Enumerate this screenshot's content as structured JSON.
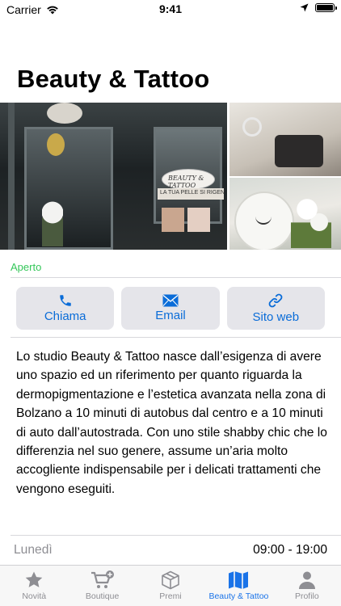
{
  "status_bar": {
    "carrier": "Carrier",
    "time": "9:41"
  },
  "page": {
    "title": "Beauty & Tattoo"
  },
  "gallery": {
    "main_photo": {
      "sign_text": "BEAUTY & TATTOO",
      "banner_text": "LA TUA PELLE SI RIGEN"
    }
  },
  "open_status": {
    "text": "Aperto",
    "color": "#34c759"
  },
  "actions": [
    {
      "label": "Chiama",
      "icon": "phone-icon"
    },
    {
      "label": "Email",
      "icon": "mail-icon"
    },
    {
      "label": "Sito web",
      "icon": "link-icon"
    }
  ],
  "description": "Lo studio Beauty & Tattoo nasce dall’esigenza di avere uno spazio ed un riferimento per quanto riguarda la dermopigmentazione e l’estetica avanzata nella zona di Bolzano a 10 minuti di autobus dal centro e a 10 minuti di auto dall’autostrada. Con uno stile shabby chic che lo differenzia nel suo genere, assume un’aria molto accogliente indispensabile per i delicati trattamenti che vengono eseguiti.",
  "hours": [
    {
      "day": "Lunedì",
      "time": "09:00 - 19:00"
    }
  ],
  "tab_bar": {
    "active_index": 3,
    "tabs": [
      {
        "label": "Novità",
        "icon": "star-icon"
      },
      {
        "label": "Boutique",
        "icon": "cart-icon"
      },
      {
        "label": "Premi",
        "icon": "box-icon"
      },
      {
        "label": "Beauty & Tattoo",
        "icon": "map-icon"
      },
      {
        "label": "Profilo",
        "icon": "person-icon"
      }
    ]
  },
  "colors": {
    "accent": "#0a6cd8",
    "tab_active": "#1a73e8",
    "tab_inactive": "#8e8e93",
    "button_bg": "#e5e5ea"
  }
}
